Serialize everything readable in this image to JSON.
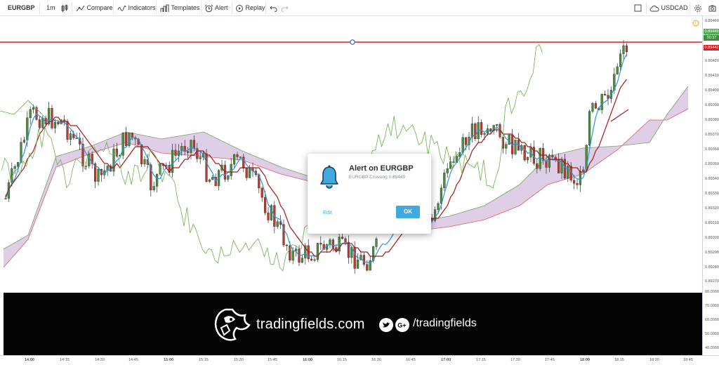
{
  "toolbar": {
    "symbol": "EURGBP",
    "interval": "1m",
    "compare_label": "Compare",
    "indicators_label": "Indicators",
    "templates_label": "Templates",
    "alert_label": "Alert",
    "replay_label": "Replay",
    "currency": "USDCAD"
  },
  "price_scale": {
    "labels": [
      "0.89460",
      "0.89440",
      "0.89430",
      "0.89420",
      "0.89410",
      "0.89400",
      "0.89390",
      "0.89380",
      "0.89370",
      "0.89360",
      "0.89350",
      "0.89340",
      "0.89330",
      "0.89320",
      "0.89310",
      "0.89300",
      "0.89290",
      "0.89280",
      "0.89270"
    ],
    "current_price": "0.89449",
    "countdown": "00:37",
    "alert_price": "0.89442"
  },
  "osc_scale": {
    "labels": [
      "80.0000",
      "70.0000",
      "60.0000",
      "50.0000",
      "40.0000"
    ]
  },
  "time_axis": {
    "labels": [
      "14:00",
      "14:15",
      "14:30",
      "14:45",
      "15:00",
      "15:15",
      "15:30",
      "15:45",
      "16:00",
      "16:15",
      "16:30",
      "16:45",
      "17:00",
      "17:15",
      "17:30",
      "17:45",
      "18:00",
      "18:15",
      "18:30",
      "18:45"
    ]
  },
  "alert_dialog": {
    "title": "Alert on EURGBP",
    "message": "EURGBP Crossing 0.89449",
    "edit_label": "Edit",
    "ok_label": "OK"
  },
  "banner": {
    "brand": "tradingfields.com",
    "handle": "/tradingfields"
  },
  "colors": {
    "alert_line": "#e01e1e",
    "cloud_fill": "#d8c7e3",
    "kijun": "#a31c1c",
    "tenkan": "#2a97d4",
    "chikou": "#6ab04c",
    "up_candle": "#4a8f3c",
    "down_candle": "#c0392b",
    "ok_button": "#3fa9e0"
  }
}
